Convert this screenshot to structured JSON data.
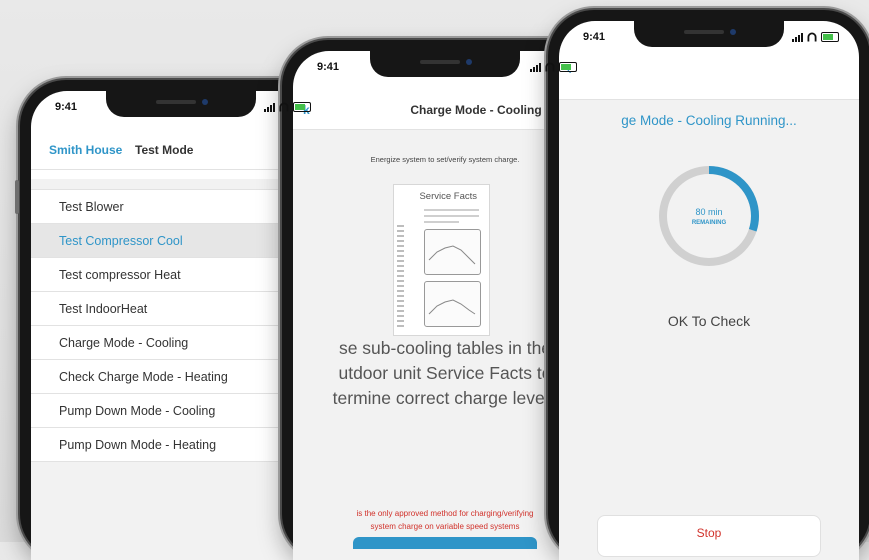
{
  "status_bar": {
    "time": "9:41"
  },
  "phone1": {
    "back_label": "Smith House",
    "title": "Test Mode",
    "items": [
      {
        "label": "Test Blower",
        "selected": false
      },
      {
        "label": "Test Compressor Cool",
        "selected": true
      },
      {
        "label": "Test compressor Heat",
        "selected": false
      },
      {
        "label": "Test IndoorHeat",
        "selected": false
      },
      {
        "label": "Charge Mode - Cooling",
        "selected": false
      },
      {
        "label": "Check Charge Mode - Heating",
        "selected": false
      },
      {
        "label": "Pump Down Mode - Cooling",
        "selected": false
      },
      {
        "label": "Pump Down Mode - Heating",
        "selected": false
      }
    ]
  },
  "phone2": {
    "back_label": "k",
    "title": "Charge Mode - Cooling",
    "note": "Energize system to set/verify system charge.",
    "doc_title": "Service Facts",
    "big_text": [
      "se sub-cooling tables in the",
      "utdoor unit Service Facts to",
      "termine correct charge levels"
    ],
    "warning": [
      "is the only approved method for charging/verifying",
      "system charge on variable speed systems"
    ]
  },
  "phone3": {
    "title": "ge Mode - Cooling  Running...",
    "timer_value": "80 min",
    "timer_sub": "REMAINING",
    "progress": 0.3,
    "ok_text": "OK To Check",
    "stop_label": "Stop"
  },
  "colors": {
    "accent": "#2f95c8",
    "warning": "#d1322b",
    "battery": "#43c04a"
  }
}
